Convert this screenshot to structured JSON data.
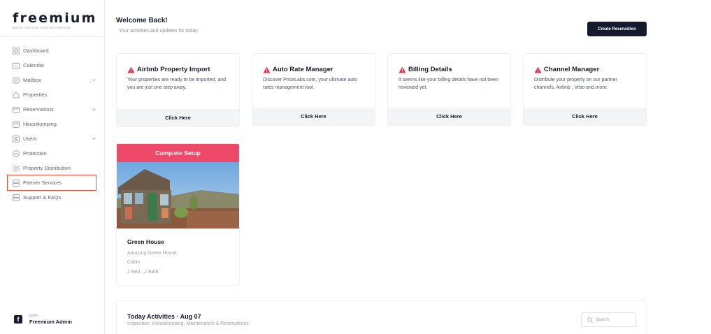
{
  "brand": {
    "name": "freemium",
    "tagline": "WHERE HOSTING CREATES FREEDOM"
  },
  "sidebar": {
    "items": [
      {
        "label": "Dashboard",
        "icon": "grid-icon",
        "chevron": false
      },
      {
        "label": "Calendar",
        "icon": "calendar-icon",
        "chevron": false
      },
      {
        "label": "Mailbox",
        "icon": "mailbox-icon",
        "chevron": true
      },
      {
        "label": "Properties",
        "icon": "home-icon",
        "chevron": false
      },
      {
        "label": "Reservations",
        "icon": "reservations-icon",
        "chevron": true
      },
      {
        "label": "Housekeeping",
        "icon": "housekeeping-icon",
        "chevron": false
      },
      {
        "label": "Users",
        "icon": "users-icon",
        "chevron": true
      },
      {
        "label": "Protection",
        "icon": "protection-icon",
        "chevron": false
      },
      {
        "label": "Property Distribution",
        "icon": "distribution-icon",
        "chevron": false
      },
      {
        "label": "Partner Services",
        "icon": "partner-icon",
        "chevron": false
      },
      {
        "label": "Support & FAQs",
        "icon": "support-icon",
        "chevron": false
      }
    ],
    "user": {
      "hello": "Hello",
      "name": "Freemium Admin",
      "avatar_letter": "f"
    }
  },
  "header": {
    "title": "Welcome Back!",
    "subtitle": "Your activities and updates for today.",
    "create_button": "Create Reservation"
  },
  "cards": [
    {
      "title": "Airbnb Property Import",
      "text": "Your properties are ready to be imported, and you are just one step away.",
      "action": "Click Here"
    },
    {
      "title": "Auto Rate Manager",
      "text": "Discover PriceLabs.com, your ultimate auto rates management tool.",
      "action": "Click Here"
    },
    {
      "title": "Billing Details",
      "text": "It seems like your billing details have not been reviewed yet.",
      "action": "Click Here"
    },
    {
      "title": "Channel Manager",
      "text": "Distribute your property on our partner channels. Airbnb , Vrbo and more.",
      "action": "Click Here"
    }
  ],
  "property": {
    "banner": "Complete Setup",
    "name": "Green House",
    "description": "Amazing Green House",
    "type": "Cabin",
    "rooms": "2 Bed , 2 Bath"
  },
  "activities": {
    "title": "Today Activities - Aug 07",
    "subtitle": "Inspection, Housekeeping, Maintenance & Reservations",
    "search_placeholder": "Search"
  },
  "colors": {
    "accent": "#ee4968",
    "dark": "#161a2e",
    "highlight": "#e2513a",
    "warning": "#e8344e"
  }
}
